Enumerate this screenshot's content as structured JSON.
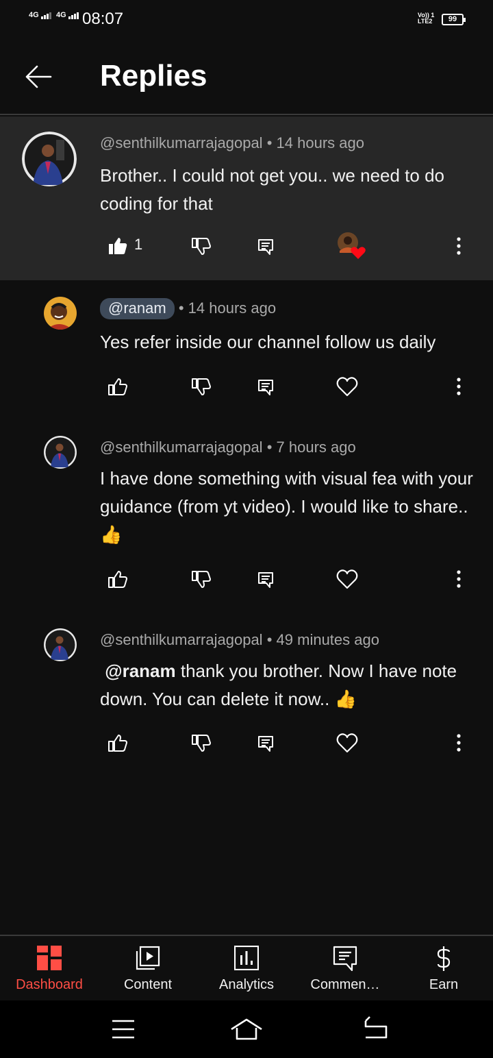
{
  "status_bar": {
    "signal1": "4G",
    "signal2": "4G",
    "time": "08:07",
    "volte_line1": "Vo)) 1",
    "volte_line2": "LTE2",
    "battery": "99"
  },
  "header": {
    "title": "Replies",
    "back_icon": "arrow-left-icon"
  },
  "comments": [
    {
      "author": "@senthilkumarrajagopal",
      "time": "14 hours ago",
      "text": "Brother.. I could not get you.. we need to do coding for that",
      "likes": "1",
      "hearted": true
    },
    {
      "author": "@ranam",
      "time": "14 hours ago",
      "text": "Yes refer inside our channel follow us daily",
      "is_creator": true
    },
    {
      "author": "@senthilkumarrajagopal",
      "time": "7 hours ago",
      "text": "I have done something with visual fea with your guidance (from yt video). I would like to share.. 👍"
    },
    {
      "author": "@senthilkumarrajagopal",
      "time": "49 minutes ago",
      "mention": "@ranam",
      "text": " thank you brother. Now I have note down. You can delete it now.. 👍"
    }
  ],
  "separator": "•",
  "bottom_nav": [
    {
      "label": "Dashboard",
      "icon": "dashboard-icon",
      "active": true
    },
    {
      "label": "Content",
      "icon": "content-icon"
    },
    {
      "label": "Analytics",
      "icon": "analytics-icon"
    },
    {
      "label": "Commen…",
      "icon": "comments-icon"
    },
    {
      "label": "Earn",
      "icon": "earn-icon"
    }
  ],
  "colors": {
    "background": "#0f0f0f",
    "highlighted_comment": "#272727",
    "accent": "#ff4e45",
    "meta_text": "#aaaaaa",
    "creator_chip": "#3e4a5a"
  }
}
